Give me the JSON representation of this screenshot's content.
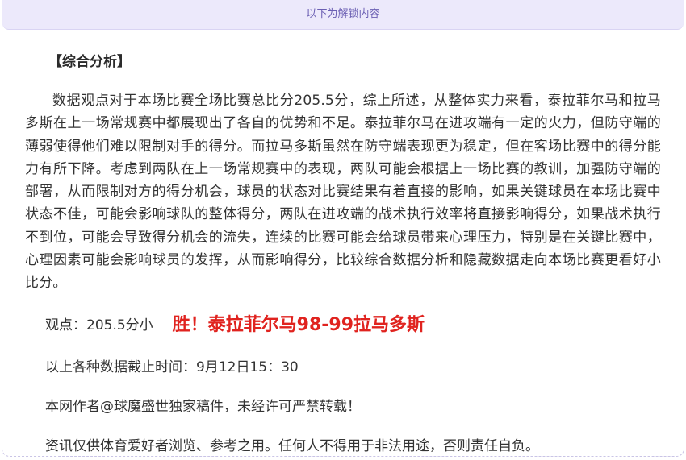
{
  "header": {
    "unlock_text": "以下为解锁内容"
  },
  "article": {
    "section_title": "【综合分析】",
    "analysis": "数据观点对于本场比赛全场比赛总比分205.5分，综上所述，从整体实力来看，泰拉菲尔马和拉马多斯在上一场常规赛中都展现出了各自的优势和不足。泰拉菲尔马在进攻端有一定的火力，但防守端的薄弱使得他们难以限制对手的得分。而拉马多斯虽然在防守端表现更为稳定，但在客场比赛中的得分能力有所下降。考虑到两队在上一场常规赛中的表现，两队可能会根据上一场比赛的教训，加强防守端的部署，从而限制对方的得分机会，球员的状态对比赛结果有着直接的影响，如果关键球员在本场比赛中状态不佳，可能会影响球队的整体得分，两队在进攻端的战术执行效率将直接影响得分，如果战术执行不到位，可能会导致得分机会的流失，连续的比赛可能会给球员带来心理压力，特别是在关键比赛中，心理因素可能会影响球员的发挥，从而影响得分，比较综合数据分析和隐藏数据走向本场比赛更看好小比分。",
    "viewpoint_label": "观点：205.5分小",
    "prediction": "胜！泰拉菲尔马98-99拉马多斯",
    "deadline": "以上各种数据截止时间：9月12日15：30",
    "author_notice": "本网作者@球魔盛世独家稿件，未经许可严禁转载！",
    "disclaimer": "资讯仅供体育爱好者浏览、参考之用。任何人不得用于非法用途，否则责任自负。"
  },
  "colors": {
    "header_bg": "#ece9fb",
    "header_text": "#6b5fb3",
    "prediction": "#e0231f",
    "body_text": "#333333"
  }
}
